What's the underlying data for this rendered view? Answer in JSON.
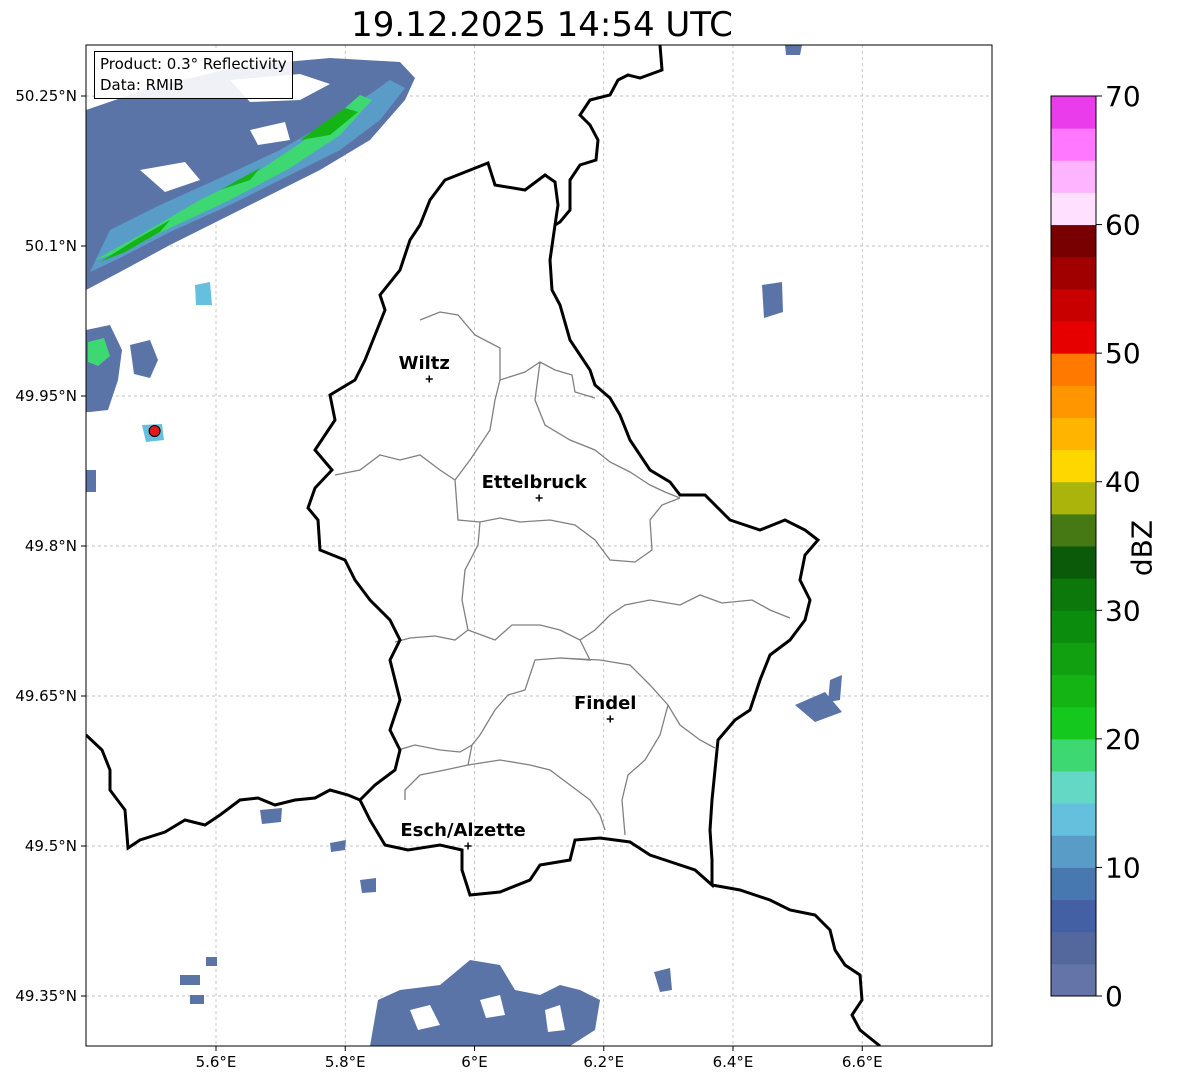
{
  "title": "19.12.2025 14:54 UTC",
  "info": {
    "product": "Product: 0.3° Reflectivity",
    "data_source": "Data: RMIB"
  },
  "map": {
    "lon_range": [
      5.4,
      6.8
    ],
    "lat_range": [
      49.3,
      50.3
    ],
    "x_ticks": [
      {
        "value": 5.6,
        "label": "5.6°E"
      },
      {
        "value": 5.8,
        "label": "5.8°E"
      },
      {
        "value": 6.0,
        "label": "6°E"
      },
      {
        "value": 6.2,
        "label": "6.2°E"
      },
      {
        "value": 6.4,
        "label": "6.4°E"
      },
      {
        "value": 6.6,
        "label": "6.6°E"
      }
    ],
    "y_ticks": [
      {
        "value": 50.25,
        "label": "50.25°N"
      },
      {
        "value": 50.1,
        "label": "50.1°N"
      },
      {
        "value": 49.95,
        "label": "49.95°N"
      },
      {
        "value": 49.8,
        "label": "49.8°N"
      },
      {
        "value": 49.65,
        "label": "49.65°N"
      },
      {
        "value": 49.5,
        "label": "49.5°N"
      },
      {
        "value": 49.35,
        "label": "49.35°N"
      }
    ],
    "grid": true,
    "cities": [
      {
        "name": "Wiltz",
        "lon": 5.93,
        "lat": 49.967
      },
      {
        "name": "Ettelbruck",
        "lon": 6.1,
        "lat": 49.848
      },
      {
        "name": "Findel",
        "lon": 6.21,
        "lat": 49.627
      },
      {
        "name": "Esch/Alzette",
        "lon": 5.99,
        "lat": 49.5
      }
    ],
    "radar_site": {
      "lon": 5.505,
      "lat": 49.915,
      "color": "#e31a1c"
    }
  },
  "colorbar": {
    "label": "dBZ",
    "min": 0,
    "max": 70,
    "ticks": [
      "0",
      "10",
      "20",
      "30",
      "40",
      "50",
      "60",
      "70"
    ],
    "colors": [
      "#6474a8",
      "#54689e",
      "#4460a4",
      "#4878b0",
      "#5a9cc8",
      "#64c0dc",
      "#64d8c4",
      "#3ed873",
      "#14c81e",
      "#14b414",
      "#10a010",
      "#0c8c0c",
      "#0c780c",
      "#0a5a0a",
      "#467814",
      "#aab40a",
      "#ffd700",
      "#ffb400",
      "#ff9600",
      "#ff7800",
      "#e60000",
      "#c80000",
      "#a00000",
      "#780000",
      "#ffe1ff",
      "#ffb4ff",
      "#ff78ff",
      "#ea3cea"
    ]
  }
}
